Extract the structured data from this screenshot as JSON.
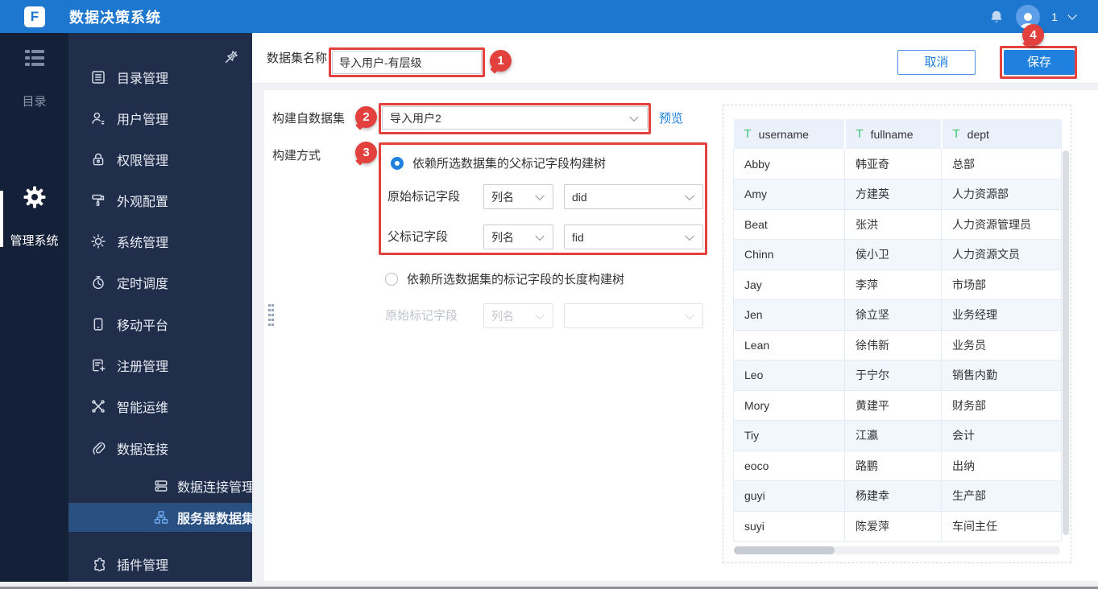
{
  "topbar": {
    "title": "数据决策系统",
    "logo_letter": "F",
    "user_count": "1",
    "bg_color": "#1E77CE"
  },
  "rail": {
    "items": [
      {
        "label": "目录",
        "icon": "menu-list-icon",
        "active": false
      },
      {
        "label": "管理系统",
        "icon": "gear-icon",
        "active": true
      }
    ]
  },
  "sidebar": {
    "items": [
      {
        "label": "目录管理",
        "icon": "catalog-icon",
        "level": 1,
        "active": false
      },
      {
        "label": "用户管理",
        "icon": "user-icon",
        "level": 1,
        "active": false
      },
      {
        "label": "权限管理",
        "icon": "lock-icon",
        "level": 1,
        "active": false
      },
      {
        "label": "外观配置",
        "icon": "paint-roller-icon",
        "level": 1,
        "active": false
      },
      {
        "label": "系统管理",
        "icon": "system-gear-icon",
        "level": 1,
        "active": false
      },
      {
        "label": "定时调度",
        "icon": "timer-icon",
        "level": 1,
        "active": false
      },
      {
        "label": "移动平台",
        "icon": "mobile-icon",
        "level": 1,
        "active": false
      },
      {
        "label": "注册管理",
        "icon": "register-icon",
        "level": 1,
        "active": false
      },
      {
        "label": "智能运维",
        "icon": "ops-icon",
        "level": 1,
        "active": false
      },
      {
        "label": "数据连接",
        "icon": "link-icon",
        "level": 1,
        "active": false
      },
      {
        "label": "数据连接管理",
        "icon": "connection-manage-icon",
        "level": 2,
        "active": false
      },
      {
        "label": "服务器数据集",
        "icon": "server-dataset-icon",
        "level": 2,
        "active": true
      },
      {
        "label": "插件管理",
        "icon": "plugin-icon",
        "level": 1,
        "active": false
      }
    ]
  },
  "header": {
    "dataset_name_label": "数据集名称",
    "dataset_name_value": "导入用户-有层级",
    "cancel_label": "取消",
    "save_label": "保存"
  },
  "form": {
    "build_from_label": "构建自数据集",
    "build_from_value": "导入用户2",
    "preview_label": "预览",
    "build_mode_label": "构建方式",
    "option_parent_label": "依赖所选数据集的父标记字段构建树",
    "option_length_label": "依赖所选数据集的标记字段的长度构建树",
    "orig_field_label": "原始标记字段",
    "parent_field_label": "父标记字段",
    "col_type_value": "列名",
    "orig_field_value": "did",
    "parent_field_value": "fid",
    "disabled_orig_field_label": "原始标记字段",
    "disabled_col_type_value": "列名",
    "disabled_field_value": ""
  },
  "annotations": {
    "color": "#E2413D",
    "m1": "1",
    "m2": "2",
    "m3": "3",
    "m4": "4"
  },
  "table": {
    "columns": [
      "username",
      "fullname",
      "dept"
    ],
    "rows": [
      [
        "Abby",
        "韩亚奇",
        "总部"
      ],
      [
        "Amy",
        "方建英",
        "人力资源部"
      ],
      [
        "Beat",
        "张洪",
        "人力资源管理员"
      ],
      [
        "Chinn",
        "侯小卫",
        "人力资源文员"
      ],
      [
        "Jay",
        "李萍",
        "市场部"
      ],
      [
        "Jen",
        "徐立坚",
        "业务经理"
      ],
      [
        "Lean",
        "徐伟新",
        "业务员"
      ],
      [
        "Leo",
        "于宁尔",
        "销售内勤"
      ],
      [
        "Mory",
        "黄建平",
        "财务部"
      ],
      [
        "Tiy",
        "江瀛",
        "会计"
      ],
      [
        "eoco",
        "路鹏",
        "出纳"
      ],
      [
        "guyi",
        "杨建幸",
        "生产部"
      ],
      [
        "suyi",
        "陈爱萍",
        "车间主任"
      ]
    ]
  },
  "accent_color": "#2080E0"
}
